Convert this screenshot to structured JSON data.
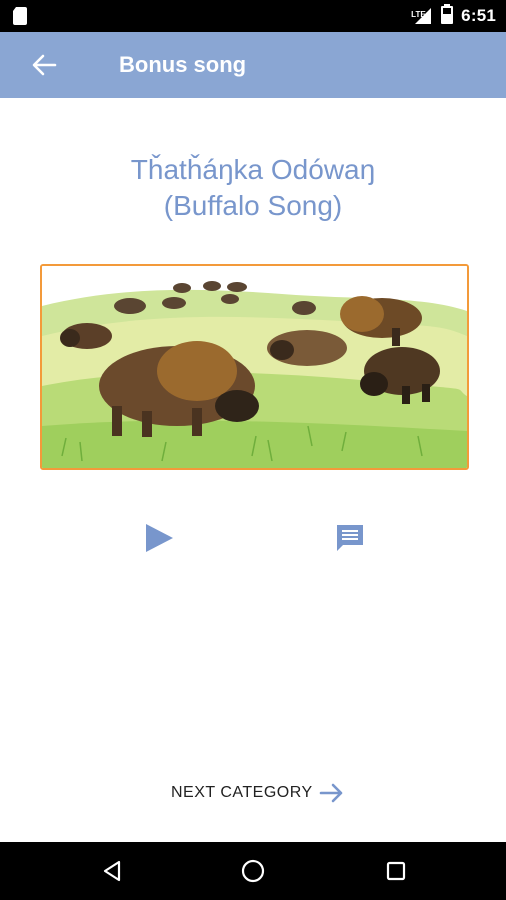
{
  "status_bar": {
    "network": "LTE",
    "time": "6:51",
    "icons": [
      "sd-card-icon",
      "signal-icon",
      "battery-icon"
    ]
  },
  "app_bar": {
    "title": "Bonus song",
    "back_icon": "arrow-left-icon"
  },
  "song": {
    "title_line1": "Tȟatȟáŋka Odówaŋ",
    "title_line2": "(Buffalo Song)",
    "image_alt": "buffalo-grazing-illustration"
  },
  "controls": {
    "play_icon": "play-icon",
    "lyrics_icon": "lyrics-icon"
  },
  "footer": {
    "next_label": "NEXT CATEGORY",
    "next_icon": "arrow-right-icon"
  },
  "nav_bar": {
    "icons": [
      "back-triangle-icon",
      "home-circle-icon",
      "recents-square-icon"
    ]
  },
  "colors": {
    "app_bar": "#8aa6d3",
    "accent_text": "#7896cc",
    "image_border": "#f39a3a"
  }
}
